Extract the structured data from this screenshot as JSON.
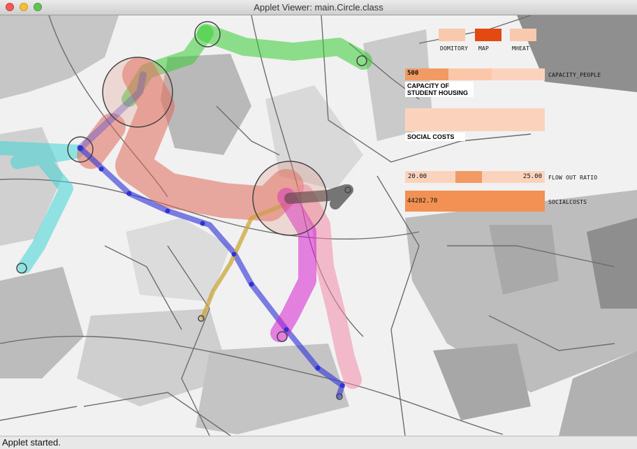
{
  "window": {
    "title": "Applet Viewer: main.Circle.class"
  },
  "status": {
    "text": "Applet started."
  },
  "colors": {
    "toggle_inactive": "#f9c9ad",
    "toggle_active": "#e24a12",
    "slider_bg": "#fbd3bd",
    "slider_fill": "#f29a63",
    "costs_fill": "#f39053",
    "route_green": "#38cc35",
    "route_red": "#e06a5a",
    "route_cyan": "#3fd4d6",
    "route_blue": "#3b3ed8",
    "route_magenta": "#d620cf",
    "route_pink": "#f08aaa",
    "route_gold": "#c9a53a",
    "route_black": "#333333"
  },
  "toggles": [
    {
      "label": "DOMITORY",
      "active": false
    },
    {
      "label": "MAP",
      "active": true
    },
    {
      "label": "MHEAT",
      "active": false
    }
  ],
  "capacity": {
    "value": "500",
    "label_right": "CAPACITY_PEOPLE",
    "caption_line1": "CAPACITY OF",
    "caption_line2": "STUDENT HOUSING",
    "fill_fraction": 0.31
  },
  "social": {
    "caption": "SOCIAL COSTS"
  },
  "flow": {
    "min": "20.00",
    "max": "25.00",
    "label": "FLOW OUT RATIO",
    "range_fraction": [
      0.36,
      0.55
    ]
  },
  "costs": {
    "value": "44282.70",
    "label": "SOCIALCOSTS"
  }
}
